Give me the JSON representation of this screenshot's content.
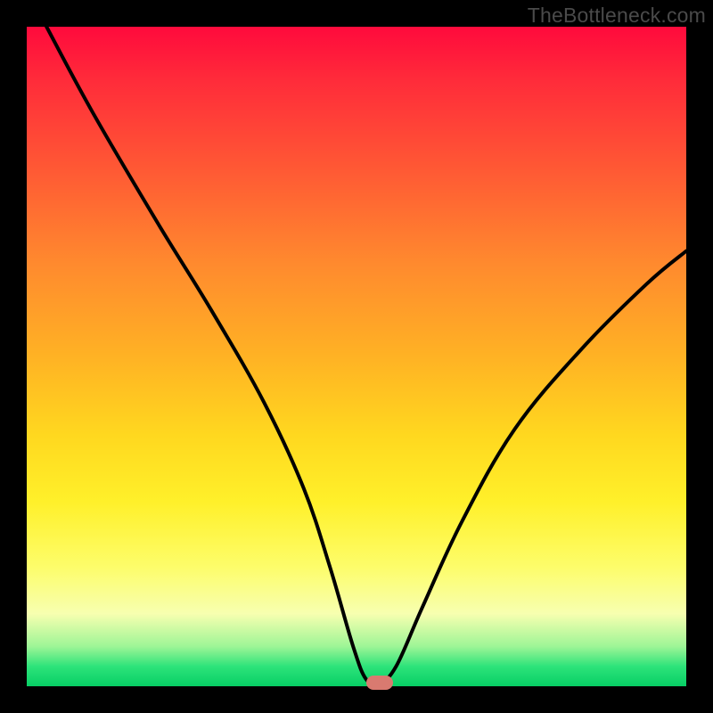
{
  "watermark": "TheBottleneck.com",
  "chart_data": {
    "type": "line",
    "title": "",
    "xlabel": "",
    "ylabel": "",
    "xlim": [
      0,
      100
    ],
    "ylim": [
      0,
      100
    ],
    "series": [
      {
        "name": "bottleneck-curve",
        "x": [
          3,
          10,
          20,
          28,
          36,
          42,
          46,
          49.5,
          51.5,
          53.5,
          56,
          60,
          66,
          74,
          84,
          94,
          100
        ],
        "y": [
          100,
          87,
          70,
          57,
          43,
          30,
          18,
          6,
          1,
          0.5,
          3,
          12,
          25,
          39,
          51,
          61,
          66
        ]
      }
    ],
    "marker": {
      "x": 53.5,
      "y": 0.5,
      "color": "#d97a70"
    },
    "gradient_stops": [
      {
        "pos": 0,
        "color": "#ff0a3c"
      },
      {
        "pos": 8,
        "color": "#ff2b3a"
      },
      {
        "pos": 22,
        "color": "#ff5a34"
      },
      {
        "pos": 36,
        "color": "#ff8a2e"
      },
      {
        "pos": 50,
        "color": "#ffb224"
      },
      {
        "pos": 62,
        "color": "#ffd81f"
      },
      {
        "pos": 72,
        "color": "#fff02a"
      },
      {
        "pos": 82,
        "color": "#fdfd6b"
      },
      {
        "pos": 89,
        "color": "#f7ffb0"
      },
      {
        "pos": 94,
        "color": "#9df596"
      },
      {
        "pos": 97,
        "color": "#2de37a"
      },
      {
        "pos": 100,
        "color": "#07cf65"
      }
    ]
  }
}
